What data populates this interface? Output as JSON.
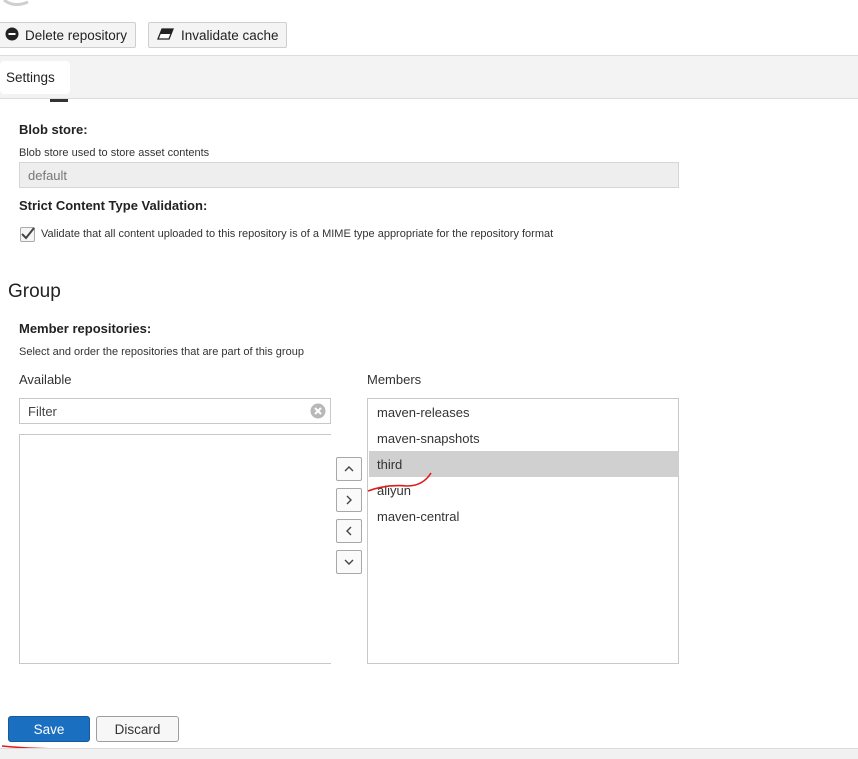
{
  "toolbar": {
    "delete_label": "Delete repository",
    "invalidate_label": "Invalidate cache"
  },
  "tabs": {
    "settings_label": "Settings"
  },
  "storage": {
    "blob_store_label": "Blob store:",
    "blob_store_help": "Blob store used to store asset contents",
    "blob_store_value": "default",
    "strict_label": "Strict Content Type Validation:",
    "strict_checkbox_text": "Validate that all content uploaded to this repository is of a MIME type appropriate for the repository format",
    "strict_checked": true
  },
  "group": {
    "heading": "Group",
    "member_label": "Member repositories:",
    "member_help": "Select and order the repositories that are part of this group",
    "available_label": "Available",
    "members_label": "Members",
    "filter_placeholder": "Filter",
    "members": [
      "maven-releases",
      "maven-snapshots",
      "third",
      "aliyun",
      "maven-central"
    ],
    "selected_member": "third"
  },
  "actions": {
    "save_label": "Save",
    "discard_label": "Discard"
  },
  "colors": {
    "save_blue": "#1a6fc0",
    "selection_gray": "#d0d0d0",
    "annotation_red": "#e01919"
  },
  "icons": {
    "delete": "minus-circle-icon",
    "invalidate": "eraser-icon",
    "clear_filter": "clear-filter-icon",
    "move_up": "chevron-up-icon",
    "move_right": "chevron-right-icon",
    "move_left": "chevron-left-icon",
    "move_down": "chevron-down-icon"
  }
}
